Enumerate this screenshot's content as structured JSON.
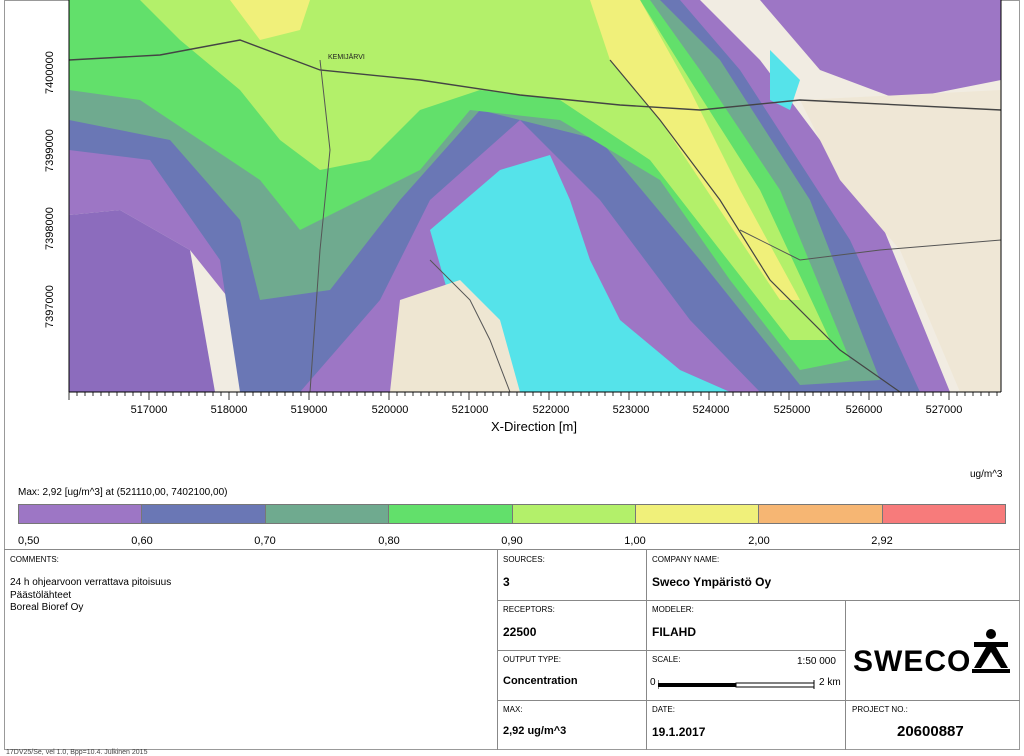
{
  "map": {
    "y_ticks": [
      "7400000",
      "7399000",
      "7398000",
      "7397000"
    ],
    "x_ticks": [
      "517000",
      "518000",
      "519000",
      "520000",
      "521000",
      "522000",
      "523000",
      "524000",
      "525000",
      "526000",
      "527000"
    ],
    "x_axis_title": "X-Direction [m]",
    "place_label": "KEMIJÄRVI"
  },
  "legend": {
    "unit": "ug/m^3",
    "max_text": "Max:  2,92  [ug/m^3]  at  (521110,00, 7402100,00)",
    "colors": [
      "#9d76c5",
      "#6a77b5",
      "#6faa8f",
      "#62e06b",
      "#b3f06a",
      "#f0f07a",
      "#f6b673",
      "#f77b7b"
    ],
    "ticks": [
      "0,50",
      "0,60",
      "0,70",
      "0,80",
      "0,90",
      "1,00",
      "2,00",
      "2,92"
    ]
  },
  "title_block": {
    "comments_label": "COMMENTS:",
    "comments": [
      "24 h ohjearvoon verrattava pitoisuus",
      "Päästölähteet",
      "Boreal Bioref Oy"
    ],
    "sources_label": "SOURCES:",
    "sources": "3",
    "company_label": "COMPANY NAME:",
    "company": "Sweco Ympäristö Oy",
    "receptors_label": "RECEPTORS:",
    "receptors": "22500",
    "modeler_label": "MODELER:",
    "modeler": "FILAHD",
    "output_label": "OUTPUT TYPE:",
    "output": "Concentration",
    "scale_label": "SCALE:",
    "scale": "1:50 000",
    "scalebar_start": "0",
    "scalebar_end": "2 km",
    "max_label": "MAX:",
    "max": "2,92 ug/m^3",
    "date_label": "DATE:",
    "date": "19.1.2017",
    "project_label": "PROJECT NO.:",
    "project": "20600887",
    "logo": "SWECO"
  },
  "footer": "17DV25/Se, vel 1.0, Bpp=10.4. Julkinen 2015"
}
